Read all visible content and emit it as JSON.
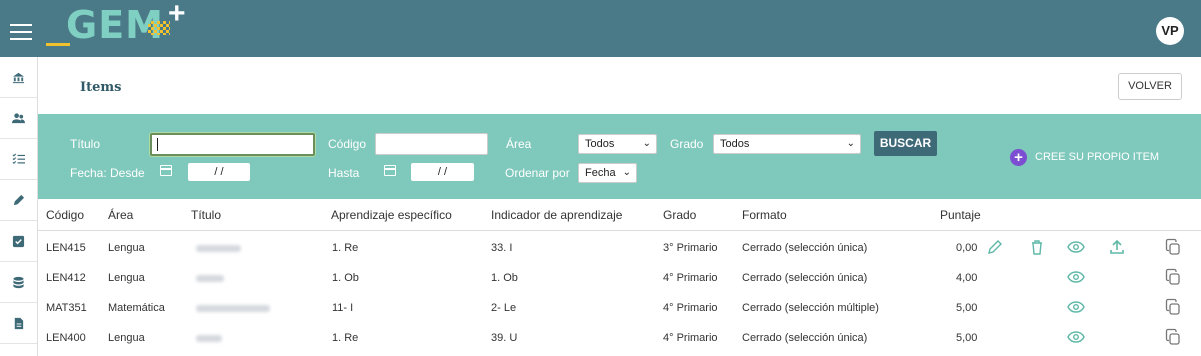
{
  "header": {
    "logo_text": "GEM",
    "logo_plus": "+",
    "avatar": "VP"
  },
  "sidebar": {
    "items": [
      {
        "icon": "institution-icon"
      },
      {
        "icon": "users-icon"
      },
      {
        "icon": "list-check-icon"
      },
      {
        "icon": "pencil-icon"
      },
      {
        "icon": "checkbox-icon"
      },
      {
        "icon": "database-icon"
      },
      {
        "icon": "document-icon"
      }
    ]
  },
  "page": {
    "title": "Items",
    "back_button": "VOLVER"
  },
  "filters": {
    "titulo_label": "Título",
    "titulo_value": "",
    "codigo_label": "Código",
    "codigo_value": "",
    "area_label": "Área",
    "area_value": "Todos",
    "grado_label": "Grado",
    "grado_value": "Todos",
    "search_button": "BUSCAR",
    "fecha_desde_label": "Fecha: Desde",
    "fecha_desde_value": "/ /",
    "hasta_label": "Hasta",
    "hasta_value": "/ /",
    "ordenar_label": "Ordenar por",
    "ordenar_value": "Fecha",
    "create_label": "CREE SU PROPIO ITEM"
  },
  "table": {
    "columns": [
      "Código",
      "Área",
      "Título",
      "Aprendizaje específico",
      "Indicador de aprendizaje",
      "Grado",
      "Formato",
      "Puntaje"
    ],
    "rows": [
      {
        "codigo": "LEN415",
        "area": "Lengua",
        "aprendizaje": "1. Re",
        "indicador": "33. I",
        "grado": "3° Primario",
        "formato": "Cerrado (selección única)",
        "puntaje": "0,00",
        "actions": [
          "edit",
          "delete",
          "view",
          "upload",
          "copy"
        ]
      },
      {
        "codigo": "LEN412",
        "area": "Lengua",
        "aprendizaje": "1. Ob",
        "indicador": "1. Ob",
        "grado": "4° Primario",
        "formato": "Cerrado (selección única)",
        "puntaje": "4,00",
        "actions": [
          "view",
          "copy"
        ]
      },
      {
        "codigo": "MAT351",
        "area": "Matemática",
        "aprendizaje": "11- I",
        "indicador": "2- Le",
        "grado": "4° Primario",
        "formato": "Cerrado (selección múltiple)",
        "puntaje": "5,00",
        "actions": [
          "view",
          "copy"
        ]
      },
      {
        "codigo": "LEN400",
        "area": "Lengua",
        "aprendizaje": "1. Re",
        "indicador": "39. U",
        "grado": "4° Primario",
        "formato": "Cerrado (selección única)",
        "puntaje": "5,00",
        "actions": [
          "view",
          "copy"
        ]
      }
    ]
  },
  "colors": {
    "topbar": "#4a7a88",
    "filter_bar": "#7fc8bc",
    "accent_icon": "#5fb8a8",
    "create_icon": "#7c4ed1",
    "search_button": "#3e6a78"
  }
}
